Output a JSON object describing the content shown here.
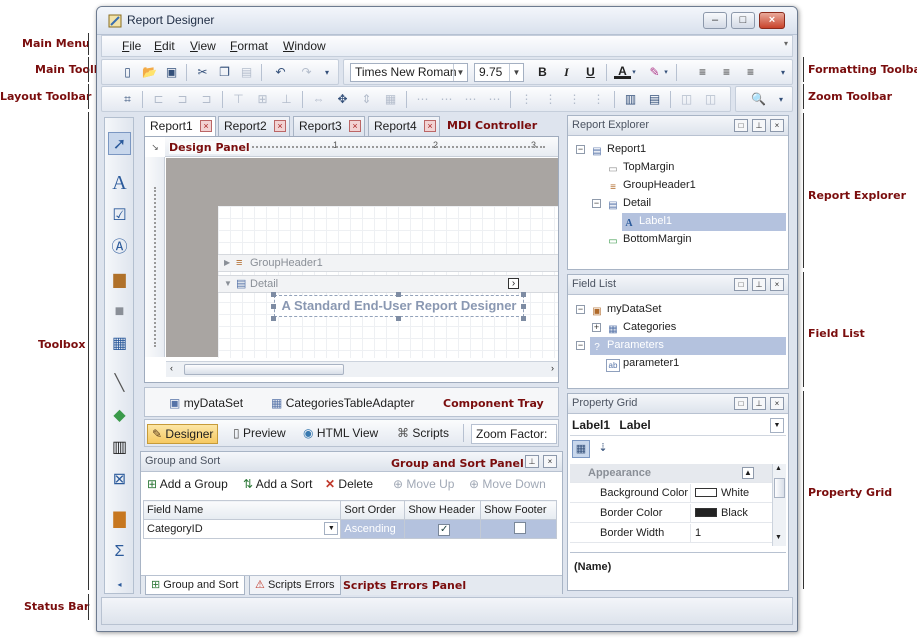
{
  "callouts": {
    "main_menu": "Main Menu",
    "main_toolbar": "Main Toolbar",
    "layout_toolbar": "Layout Toolbar",
    "toolbox": "Toolbox",
    "status_bar": "Status Bar",
    "formatting_toolbar": "Formatting Toolbar",
    "zoom_toolbar": "Zoom Toolbar",
    "report_explorer": "Report Explorer",
    "field_list": "Field List",
    "property_grid": "Property Grid",
    "mdi_controller": "MDI Controller",
    "design_panel": "Design Panel",
    "component_tray": "Component Tray",
    "group_sort_panel": "Group and Sort Panel",
    "scripts_errors_panel": "Scripts Errors Panel"
  },
  "window": {
    "title": "Report Designer",
    "minimize": "–",
    "maximize": "□",
    "close": "×"
  },
  "menu": [
    "File",
    "Edit",
    "View",
    "Format",
    "Window"
  ],
  "formatting": {
    "font_name": "Times New Roman",
    "font_size": "9.75",
    "bold": "B",
    "italic": "I",
    "underline": "U",
    "font_color": "A"
  },
  "mdi_tabs": [
    "Report1",
    "Report2",
    "Report3",
    "Report4"
  ],
  "ruler_ticks": [
    "1",
    "2",
    "3"
  ],
  "design": {
    "group_header": "GroupHeader1",
    "detail": "Detail",
    "label_text": "A Standard End-User Report Designer",
    "smart_tag": "›"
  },
  "tray": {
    "items": [
      "myDataSet",
      "CategoriesTableAdapter"
    ]
  },
  "view_tabs": [
    "Designer",
    "Preview",
    "HTML View",
    "Scripts"
  ],
  "zoom_factor": "Zoom Factor:",
  "group_sort": {
    "title": "Group and Sort",
    "buttons": [
      "Add a Group",
      "Add a Sort",
      "Delete",
      "Move Up",
      "Move Down"
    ],
    "columns": [
      "Field Name",
      "Sort Order",
      "Show Header",
      "Show Footer"
    ],
    "rows": [
      {
        "field": "CategoryID",
        "sort": "Ascending",
        "show_header": true,
        "show_footer": false
      }
    ],
    "bottom_tabs": [
      "Group and Sort",
      "Scripts Errors"
    ]
  },
  "report_explorer": {
    "title": "Report Explorer",
    "items": [
      {
        "label": "Report1",
        "level": 0,
        "selected": false
      },
      {
        "label": "TopMargin",
        "level": 1,
        "selected": false
      },
      {
        "label": "GroupHeader1",
        "level": 1,
        "selected": false
      },
      {
        "label": "Detail",
        "level": 1,
        "selected": false
      },
      {
        "label": "Label1",
        "level": 2,
        "selected": true
      },
      {
        "label": "BottomMargin",
        "level": 1,
        "selected": false
      }
    ]
  },
  "field_list": {
    "title": "Field List",
    "items": [
      {
        "label": "myDataSet",
        "level": 0,
        "selected": false
      },
      {
        "label": "Categories",
        "level": 1,
        "selected": false
      },
      {
        "label": "Parameters",
        "level": 0,
        "selected": true
      },
      {
        "label": "parameter1",
        "level": 1,
        "selected": false
      }
    ]
  },
  "property_grid": {
    "title": "Property Grid",
    "selected_name": "Label1",
    "selected_type": "Label",
    "category": "Appearance",
    "properties": [
      {
        "name": "Background Color",
        "value": "White",
        "swatch": "#ffffff"
      },
      {
        "name": "Border Color",
        "value": "Black",
        "swatch": "#222222"
      },
      {
        "name": "Border Width",
        "value": "1",
        "swatch": ""
      }
    ],
    "description": "(Name)"
  }
}
